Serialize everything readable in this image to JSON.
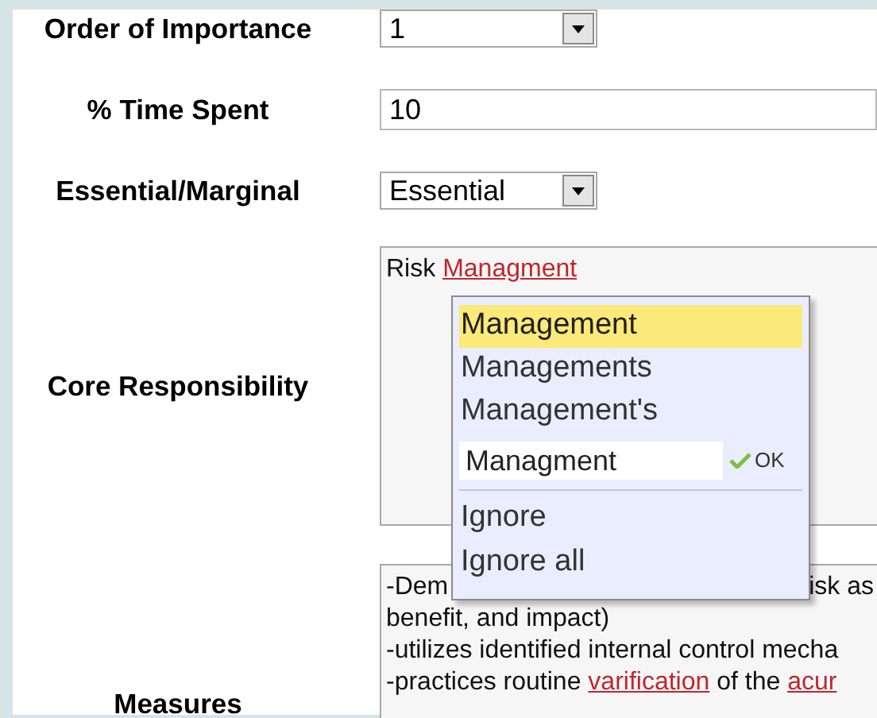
{
  "fields": [
    {
      "kind": "select",
      "label": "Order of Importance",
      "value": "1"
    },
    {
      "kind": "text",
      "label": "% Time Spent",
      "value": "10"
    },
    {
      "kind": "select",
      "label": "Essential/Marginal",
      "value": "Essential"
    },
    {
      "kind": "textarea",
      "label": "Core Responsibility",
      "lines": [
        [
          {
            "text": "Risk "
          },
          {
            "text": "Managment",
            "misspelled": true
          }
        ]
      ]
    },
    {
      "kind": "textarea",
      "label": "Measures",
      "lines": [
        [
          {
            "text": "-Dem"
          },
          {
            "text": "isk as",
            "after_popup": true
          }
        ],
        [
          {
            "text": "benefit, and impact)"
          }
        ],
        [
          {
            "text": "-utilizes identified internal control mecha"
          }
        ],
        [
          {
            "text": "-practices routine "
          },
          {
            "text": "varification",
            "misspelled": true
          },
          {
            "text": " of the "
          },
          {
            "text": "acur",
            "misspelled": true
          }
        ]
      ]
    }
  ],
  "spell_menu": {
    "suggestions": [
      {
        "text": "Management",
        "selected": true
      },
      {
        "text": "Managements",
        "selected": false
      },
      {
        "text": "Management's",
        "selected": false
      }
    ],
    "replacement": "Managment",
    "ok": "OK",
    "actions": [
      "Ignore",
      "Ignore all"
    ]
  }
}
